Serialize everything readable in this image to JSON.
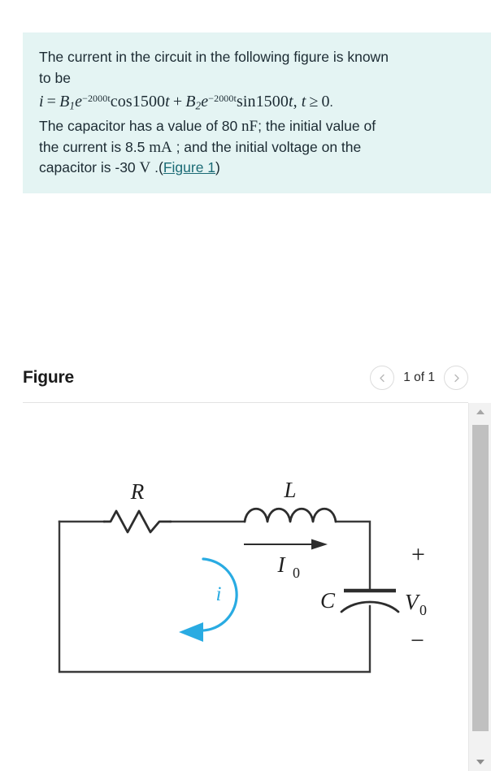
{
  "question": {
    "line1": "The current in the circuit in the following figure is known",
    "line2": "to be",
    "equation": {
      "lhs_i": "i",
      "equals": "=",
      "b1": "B",
      "b1_sub": "1",
      "e1": "e",
      "exp1": "−2000t",
      "cos": "cos1500",
      "cos_var": "t",
      "plus": "+",
      "b2": "B",
      "b2_sub": "2",
      "e2": "e",
      "exp2": "−2000t",
      "sin": "sin1500",
      "sin_var": "t",
      "comma": ",",
      "t_var": "t",
      "geq": "≥",
      "zero": "0",
      "period": "."
    },
    "line4_a": "The capacitor has a value of 80 ",
    "line4_unit": "nF",
    "line4_b": "; the initial value of",
    "line5_a": "the current is 8.5 ",
    "line5_unit": "mA",
    "line5_b": " ; and the initial voltage on the",
    "line6_a": "capacitor is -30 ",
    "line6_unit": "V",
    "line6_b": " .(",
    "figure_link": "Figure 1",
    "line6_c": ")",
    "panel_bg": "#e4f4f3",
    "link_color": "#1b6b75"
  },
  "figure": {
    "title": "Figure",
    "pager_label": "1 of 1",
    "prev_icon": "chevron-left-icon",
    "next_icon": "chevron-right-icon"
  },
  "scrollbar": {
    "up_icon": "triangle-up-icon",
    "down_icon": "triangle-down-icon",
    "track_color": "#f2f2f2",
    "thumb_color": "#c0c0c0"
  },
  "circuit": {
    "resistor_label": "R",
    "inductor_label": "L",
    "current_arrow_label": "I",
    "current_arrow_sub": "0",
    "loop_current_label": "i",
    "capacitor_label": "C",
    "voltage_label": "V",
    "voltage_sub": "0",
    "plus_sign": "+",
    "minus_sign": "−",
    "loop_color": "#29abe2",
    "wire_color": "#3a3a3a"
  }
}
